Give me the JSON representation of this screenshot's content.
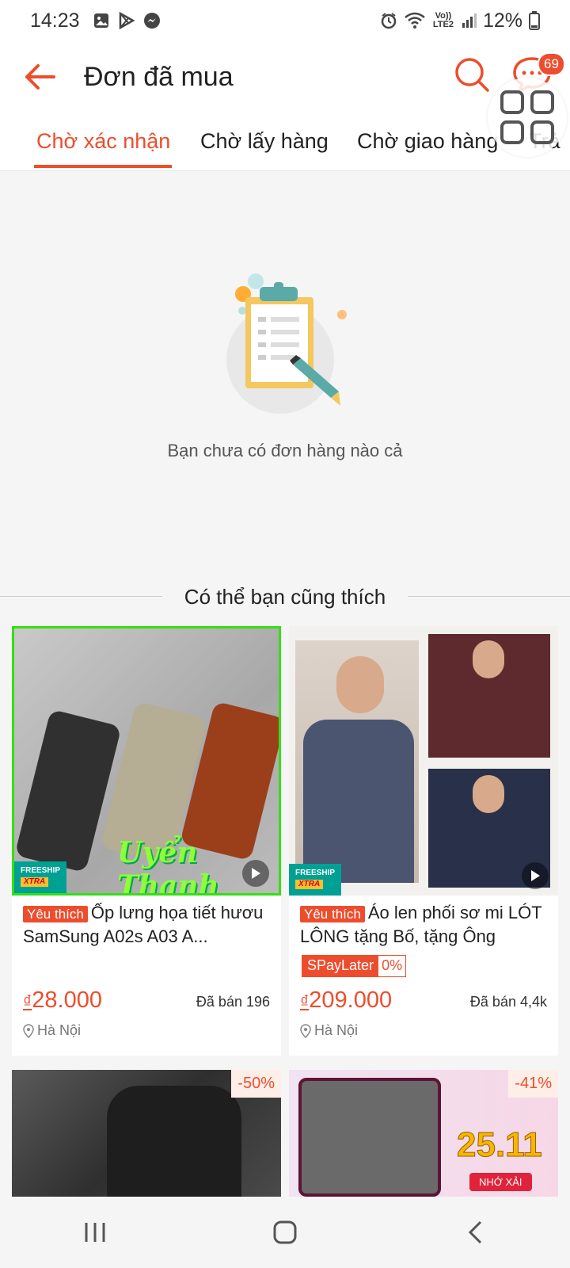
{
  "status_bar": {
    "time": "14:23",
    "volte": "Vo)) LTE2",
    "battery": "12%"
  },
  "header": {
    "title": "Đơn đã mua",
    "chat_badge": "69"
  },
  "tabs": [
    {
      "label": "Chờ xác nhận",
      "active": true
    },
    {
      "label": "Chờ lấy hàng",
      "active": false
    },
    {
      "label": "Chờ giao hàng",
      "active": false
    },
    {
      "label": "Trả",
      "active": false
    }
  ],
  "empty_state": {
    "message": "Bạn chưa có đơn hàng nào cả"
  },
  "recommend": {
    "heading": "Có thể bạn cũng thích",
    "products": [
      {
        "badge": "Yêu thích",
        "title": "Ốp lưng họa tiết hươu SamSung A02s A03 A...",
        "price_currency": "₫",
        "price": "28.000",
        "sold": "Đã bán 196",
        "location": "Hà Nội",
        "freeship": "FREESHIP",
        "freeship_tag": "XTRA",
        "watermark": "Uyển Thanh"
      },
      {
        "badge": "Yêu thích",
        "title": "Áo len phối sơ mi LÓT LÔNG tặng Bố, tặng Ông",
        "promo_label": "SPayLater",
        "promo_value": "0%",
        "price_currency": "₫",
        "price": "209.000",
        "sold": "Đã bán 4,4k",
        "location": "Hà Nội",
        "freeship": "FREESHIP",
        "freeship_tag": "XTRA"
      },
      {
        "discount": "-50%"
      },
      {
        "discount": "-41%",
        "banner_date": "25.11",
        "banner_button": "NHỚ XẢI"
      }
    ]
  },
  "colors": {
    "accent": "#ee4d2d",
    "freeship": "#00a095",
    "selected_border": "#34e014"
  }
}
